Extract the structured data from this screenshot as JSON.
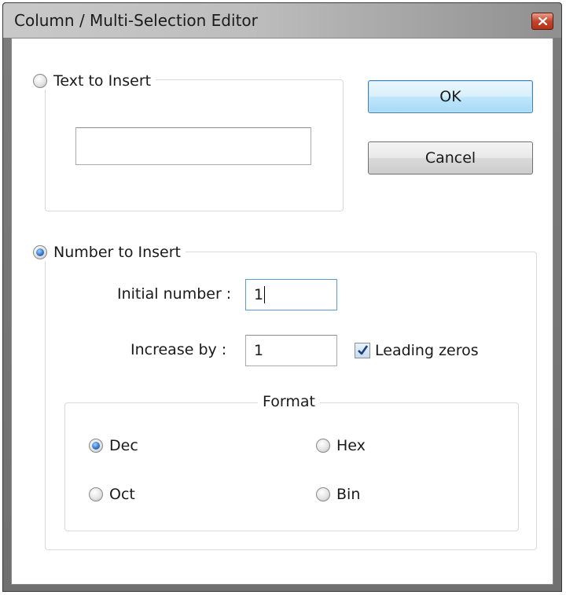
{
  "window": {
    "title": "Column / Multi-Selection Editor"
  },
  "text_group": {
    "label": "Text to Insert",
    "selected": false,
    "value": ""
  },
  "buttons": {
    "ok_label": "OK",
    "cancel_label": "Cancel"
  },
  "number_group": {
    "label": "Number to Insert",
    "selected": true,
    "initial_label": "Initial number :",
    "initial_value": "1",
    "increase_label": "Increase by :",
    "increase_value": "1",
    "leading_zeros_label": "Leading zeros",
    "leading_zeros_checked": true
  },
  "format": {
    "label": "Format",
    "options": [
      {
        "label": "Dec",
        "selected": true
      },
      {
        "label": "Hex",
        "selected": false
      },
      {
        "label": "Oct",
        "selected": false
      },
      {
        "label": "Bin",
        "selected": false
      }
    ]
  },
  "colors": {
    "accent": "#2f6fc7",
    "close": "#c5452c",
    "default_button": "#a7d9f5"
  }
}
